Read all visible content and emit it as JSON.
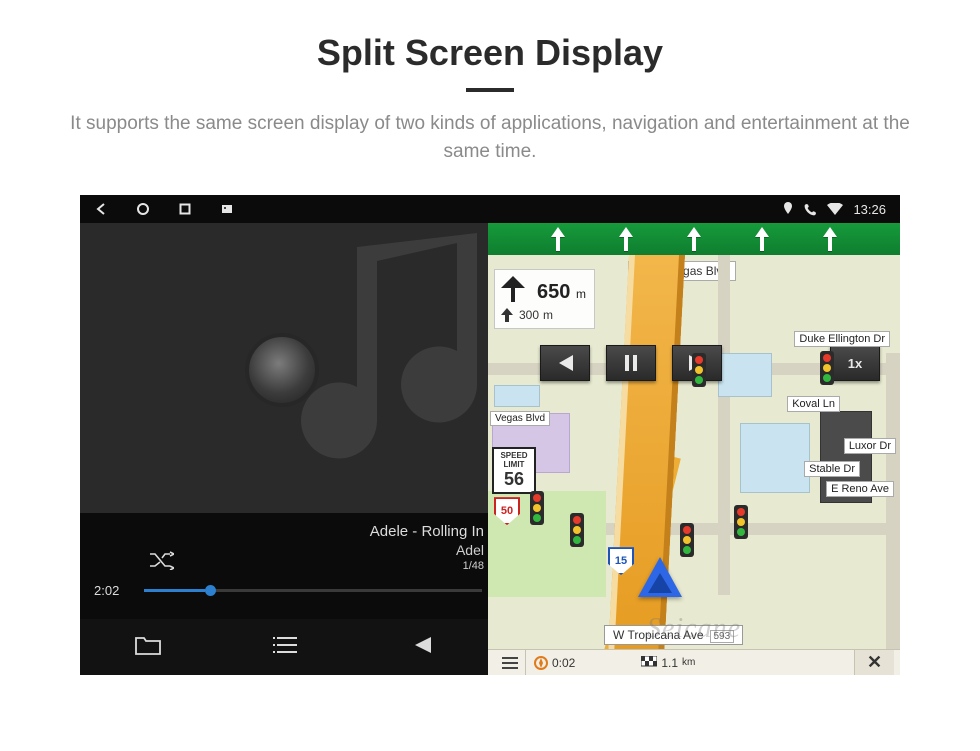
{
  "page": {
    "title": "Split Screen Display",
    "subtitle": "It supports the same screen display of two kinds of applications, navigation and entertainment at the same time."
  },
  "statusbar": {
    "time": "13:26"
  },
  "music": {
    "track_line1": "Adele - Rolling In",
    "track_line2": "Adel",
    "track_index": "1/48",
    "elapsed": "2:02"
  },
  "nav": {
    "top_street": "S Las Vegas Blvd",
    "turn_distance": "650",
    "turn_unit": "m",
    "next_distance": "300",
    "next_unit": "m",
    "speed_limit_label": "SPEED LIMIT",
    "speed_limit_value": "56",
    "shield_15": "15",
    "shield_50": "50",
    "labels": {
      "duke": "Duke Ellington Dr",
      "koval": "Koval Ln",
      "luxor": "Luxor Dr",
      "reno": "E Reno Ave",
      "stable": "Stable Dr",
      "vegas": "Vegas Blvd"
    },
    "bottom_street": "W Tropicana Ave",
    "bottom_street_num": "593",
    "playback_speed": "1x",
    "trip": {
      "elapsed": "0:02",
      "remaining": "1.1",
      "remaining_unit": "km"
    }
  },
  "watermark": "Seicane"
}
